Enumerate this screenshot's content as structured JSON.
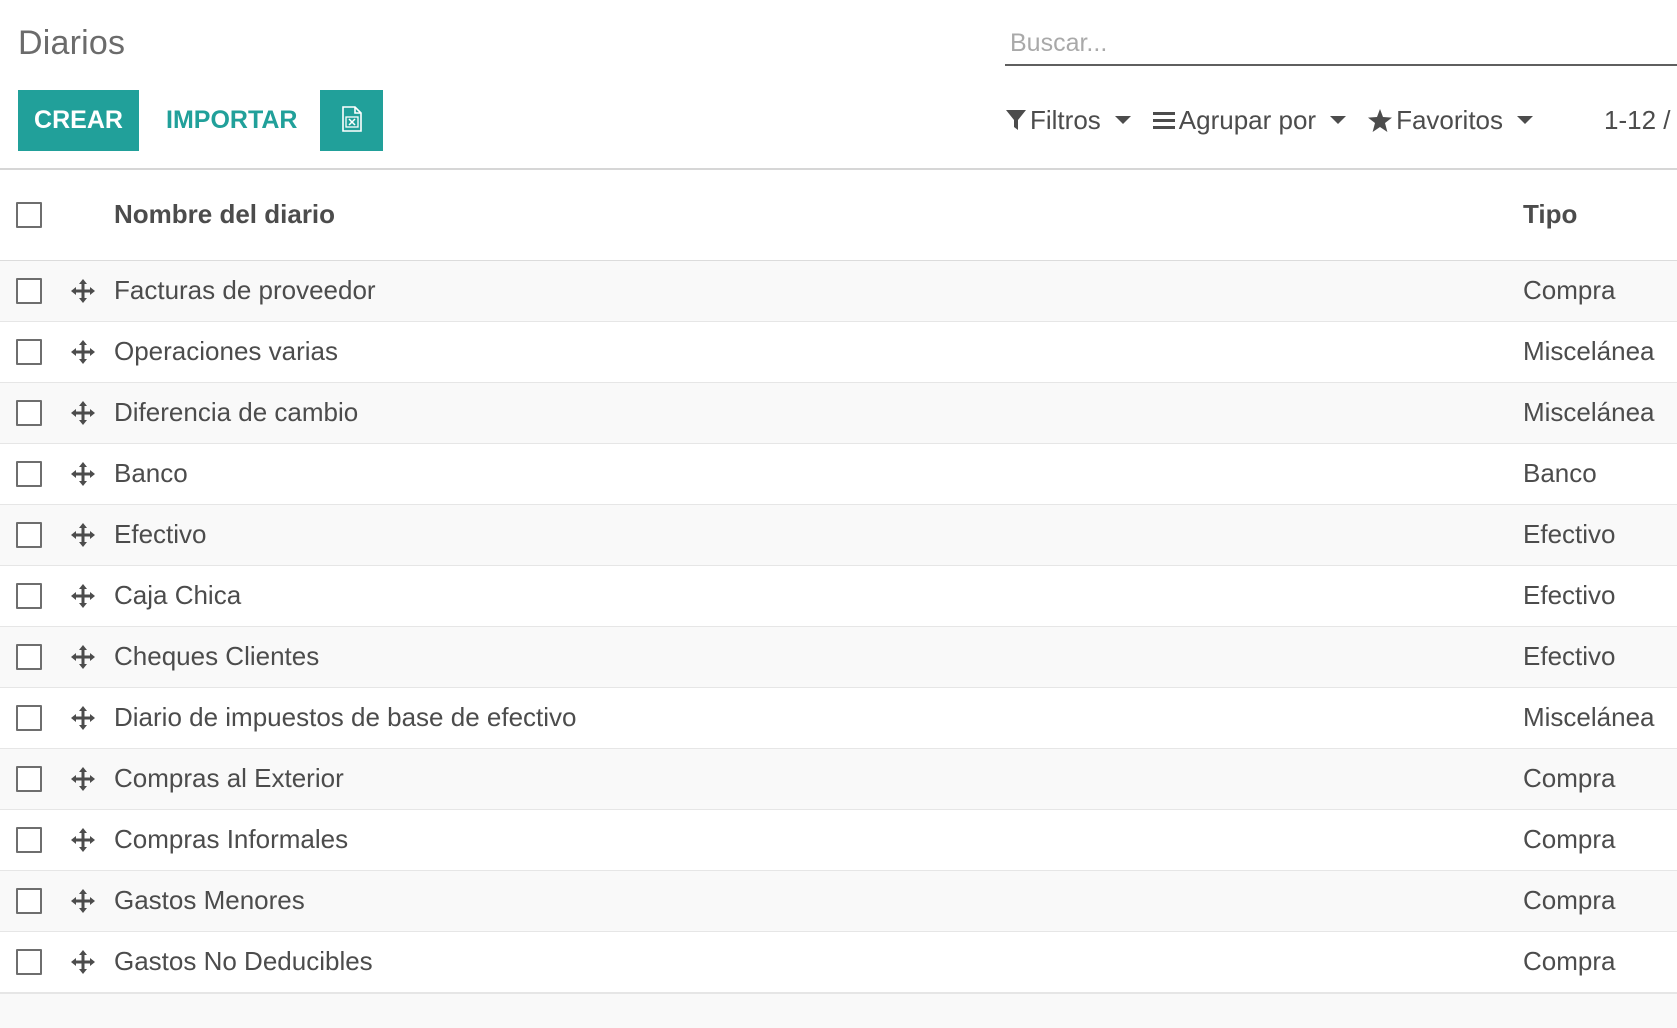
{
  "breadcrumb": "Diarios",
  "search": {
    "placeholder": "Buscar..."
  },
  "buttons": {
    "create": "CREAR",
    "import": "IMPORTAR",
    "excel_icon": "excel-file-icon"
  },
  "search_options": {
    "filters": "Filtros",
    "group_by": "Agrupar por",
    "favorites": "Favoritos"
  },
  "pager": "1-12 /",
  "accent_color": "#21a09a",
  "table": {
    "headers": {
      "name": "Nombre del diario",
      "type": "Tipo"
    },
    "rows": [
      {
        "name": "Facturas de proveedor",
        "type": "Compra"
      },
      {
        "name": "Operaciones varias",
        "type": "Miscelánea"
      },
      {
        "name": "Diferencia de cambio",
        "type": "Miscelánea"
      },
      {
        "name": "Banco",
        "type": "Banco"
      },
      {
        "name": "Efectivo",
        "type": "Efectivo"
      },
      {
        "name": "Caja Chica",
        "type": "Efectivo"
      },
      {
        "name": "Cheques Clientes",
        "type": "Efectivo"
      },
      {
        "name": "Diario de impuestos de base de efectivo",
        "type": "Miscelánea"
      },
      {
        "name": "Compras al Exterior",
        "type": "Compra"
      },
      {
        "name": "Compras Informales",
        "type": "Compra"
      },
      {
        "name": "Gastos Menores",
        "type": "Compra"
      },
      {
        "name": "Gastos No Deducibles",
        "type": "Compra"
      }
    ]
  }
}
